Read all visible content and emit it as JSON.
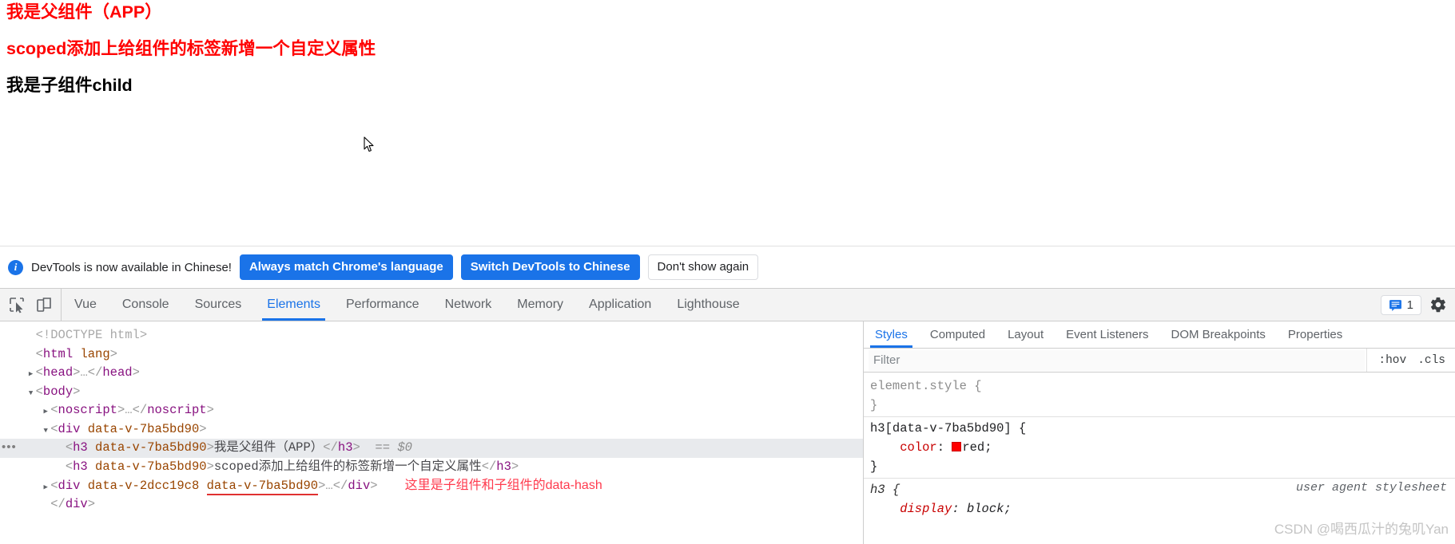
{
  "page": {
    "headings": [
      {
        "text": "我是父组件（APP）",
        "color": "#ff0000"
      },
      {
        "text": "scoped添加上给组件的标签新增一个自定义属性",
        "color": "#ff0000"
      },
      {
        "text": "我是子组件child",
        "color": "#000000"
      }
    ]
  },
  "banner": {
    "info_icon": "info-icon",
    "message": "DevTools is now available in Chinese!",
    "buttons": [
      {
        "label": "Always match Chrome's language",
        "style": "primary"
      },
      {
        "label": "Switch DevTools to Chinese",
        "style": "primary"
      },
      {
        "label": "Don't show again",
        "style": "secondary"
      }
    ]
  },
  "devtools_toolbar": {
    "icons": [
      {
        "name": "inspect-element-icon"
      },
      {
        "name": "device-toolbar-icon"
      }
    ],
    "tabs": [
      {
        "label": "Vue",
        "active": false
      },
      {
        "label": "Console",
        "active": false
      },
      {
        "label": "Sources",
        "active": false
      },
      {
        "label": "Elements",
        "active": true
      },
      {
        "label": "Performance",
        "active": false
      },
      {
        "label": "Network",
        "active": false
      },
      {
        "label": "Memory",
        "active": false
      },
      {
        "label": "Application",
        "active": false
      },
      {
        "label": "Lighthouse",
        "active": false
      }
    ],
    "message_count": "1",
    "settings_icon": "gear-icon"
  },
  "dom_tree": {
    "lines": [
      {
        "id": 0,
        "indent": 0,
        "arrow": "none",
        "selected": false,
        "dots": false,
        "segments": [
          {
            "cls": "tw-doctype",
            "text": "<!DOCTYPE html>"
          }
        ]
      },
      {
        "id": 1,
        "indent": 0,
        "arrow": "none",
        "selected": false,
        "dots": false,
        "segments": [
          {
            "cls": "tw-punct",
            "text": "<"
          },
          {
            "cls": "tw-tag",
            "text": "html"
          },
          {
            "cls": "tw-attr",
            "text": " lang"
          },
          {
            "cls": "tw-punct",
            "text": ">"
          }
        ]
      },
      {
        "id": 2,
        "indent": 0,
        "arrow": "right",
        "selected": false,
        "dots": false,
        "segments": [
          {
            "cls": "tw-punct",
            "text": "<"
          },
          {
            "cls": "tw-tag",
            "text": "head"
          },
          {
            "cls": "tw-punct",
            "text": ">"
          },
          {
            "cls": "tw-ellip",
            "text": "…"
          },
          {
            "cls": "tw-punct",
            "text": "</"
          },
          {
            "cls": "tw-tag",
            "text": "head"
          },
          {
            "cls": "tw-punct",
            "text": ">"
          }
        ]
      },
      {
        "id": 3,
        "indent": 0,
        "arrow": "down",
        "selected": false,
        "dots": false,
        "segments": [
          {
            "cls": "tw-punct",
            "text": "<"
          },
          {
            "cls": "tw-tag",
            "text": "body"
          },
          {
            "cls": "tw-punct",
            "text": ">"
          }
        ]
      },
      {
        "id": 4,
        "indent": 1,
        "arrow": "right",
        "selected": false,
        "dots": false,
        "segments": [
          {
            "cls": "tw-punct",
            "text": "<"
          },
          {
            "cls": "tw-tag",
            "text": "noscript"
          },
          {
            "cls": "tw-punct",
            "text": ">"
          },
          {
            "cls": "tw-ellip",
            "text": "…"
          },
          {
            "cls": "tw-punct",
            "text": "</"
          },
          {
            "cls": "tw-tag",
            "text": "noscript"
          },
          {
            "cls": "tw-punct",
            "text": ">"
          }
        ]
      },
      {
        "id": 5,
        "indent": 1,
        "arrow": "down",
        "selected": false,
        "dots": false,
        "segments": [
          {
            "cls": "tw-punct",
            "text": "<"
          },
          {
            "cls": "tw-tag",
            "text": "div"
          },
          {
            "cls": "tw-attr",
            "text": " data-v-7ba5bd90"
          },
          {
            "cls": "tw-punct",
            "text": ">"
          }
        ]
      },
      {
        "id": 6,
        "indent": 2,
        "arrow": "none",
        "selected": true,
        "dots": true,
        "segments": [
          {
            "cls": "tw-punct",
            "text": "<"
          },
          {
            "cls": "tw-tag",
            "text": "h3"
          },
          {
            "cls": "tw-attr",
            "text": " data-v-7ba5bd90"
          },
          {
            "cls": "tw-punct",
            "text": ">"
          },
          {
            "cls": "tw-txt",
            "text": "我是父组件（APP）"
          },
          {
            "cls": "tw-punct",
            "text": "</"
          },
          {
            "cls": "tw-tag",
            "text": "h3"
          },
          {
            "cls": "tw-punct",
            "text": ">"
          },
          {
            "cls": "tw-dollar",
            "text": "  == $0"
          }
        ]
      },
      {
        "id": 7,
        "indent": 2,
        "arrow": "none",
        "selected": false,
        "dots": false,
        "segments": [
          {
            "cls": "tw-punct",
            "text": "<"
          },
          {
            "cls": "tw-tag",
            "text": "h3"
          },
          {
            "cls": "tw-attr",
            "text": " data-v-7ba5bd90"
          },
          {
            "cls": "tw-punct",
            "text": ">"
          },
          {
            "cls": "tw-txt",
            "text": "scoped添加上给组件的标签新增一个自定义属性"
          },
          {
            "cls": "tw-punct",
            "text": "</"
          },
          {
            "cls": "tw-tag",
            "text": "h3"
          },
          {
            "cls": "tw-punct",
            "text": ">"
          }
        ]
      },
      {
        "id": 8,
        "indent": 1,
        "arrow": "right",
        "selected": false,
        "dots": false,
        "note": "这里是子组件和子组件的data-hash",
        "segments": [
          {
            "cls": "tw-punct",
            "text": "<"
          },
          {
            "cls": "tw-tag",
            "text": "div"
          },
          {
            "cls": "tw-attr",
            "text": " data-v-2dcc19c8 "
          },
          {
            "cls": "tw-underline",
            "text": "data-v-7ba5bd90"
          },
          {
            "cls": "tw-punct",
            "text": ">"
          },
          {
            "cls": "tw-ellip",
            "text": "…"
          },
          {
            "cls": "tw-punct",
            "text": "</"
          },
          {
            "cls": "tw-tag",
            "text": "div"
          },
          {
            "cls": "tw-punct",
            "text": ">"
          }
        ]
      },
      {
        "id": 9,
        "indent": 1,
        "arrow": "none",
        "selected": false,
        "dots": false,
        "segments": [
          {
            "cls": "tw-punct",
            "text": "</"
          },
          {
            "cls": "tw-tag",
            "text": "div"
          },
          {
            "cls": "tw-punct",
            "text": ">"
          }
        ]
      }
    ]
  },
  "styles_panel": {
    "tabs": [
      {
        "label": "Styles",
        "active": true
      },
      {
        "label": "Computed",
        "active": false
      },
      {
        "label": "Layout",
        "active": false
      },
      {
        "label": "Event Listeners",
        "active": false
      },
      {
        "label": "DOM Breakpoints",
        "active": false
      },
      {
        "label": "Properties",
        "active": false
      }
    ],
    "filter": {
      "value": "",
      "placeholder": "Filter"
    },
    "toggles": [
      ":hov",
      ".cls"
    ],
    "rules": [
      {
        "selector": "element.style {",
        "dim": true,
        "italic": false,
        "source": "",
        "declarations": [],
        "close": "}"
      },
      {
        "selector": "h3[data-v-7ba5bd90] {",
        "dim": false,
        "italic": false,
        "source": "",
        "declarations": [
          {
            "prop": "color",
            "value": "red",
            "swatch": "#ff0000"
          }
        ],
        "close": "}"
      },
      {
        "selector": "h3 {",
        "dim": false,
        "italic": true,
        "source": "user agent stylesheet",
        "declarations": [
          {
            "prop": "display",
            "value": "block",
            "swatch": ""
          }
        ],
        "close": ""
      }
    ],
    "watermark": "CSDN @喝西瓜汁的兔叽Yan"
  }
}
